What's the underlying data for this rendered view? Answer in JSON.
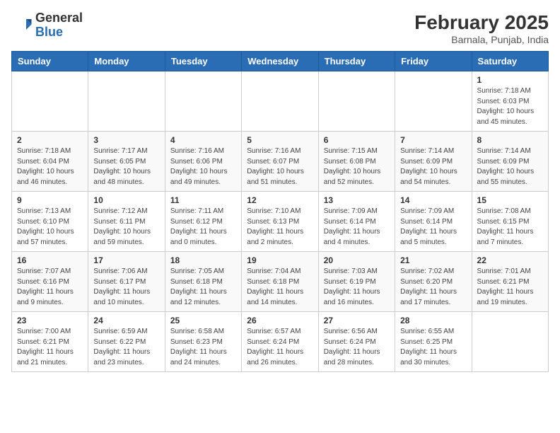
{
  "header": {
    "logo_general": "General",
    "logo_blue": "Blue",
    "month_title": "February 2025",
    "location": "Barnala, Punjab, India"
  },
  "days_of_week": [
    "Sunday",
    "Monday",
    "Tuesday",
    "Wednesday",
    "Thursday",
    "Friday",
    "Saturday"
  ],
  "weeks": [
    [
      {
        "day": "",
        "info": ""
      },
      {
        "day": "",
        "info": ""
      },
      {
        "day": "",
        "info": ""
      },
      {
        "day": "",
        "info": ""
      },
      {
        "day": "",
        "info": ""
      },
      {
        "day": "",
        "info": ""
      },
      {
        "day": "1",
        "info": "Sunrise: 7:18 AM\nSunset: 6:03 PM\nDaylight: 10 hours\nand 45 minutes."
      }
    ],
    [
      {
        "day": "2",
        "info": "Sunrise: 7:18 AM\nSunset: 6:04 PM\nDaylight: 10 hours\nand 46 minutes."
      },
      {
        "day": "3",
        "info": "Sunrise: 7:17 AM\nSunset: 6:05 PM\nDaylight: 10 hours\nand 48 minutes."
      },
      {
        "day": "4",
        "info": "Sunrise: 7:16 AM\nSunset: 6:06 PM\nDaylight: 10 hours\nand 49 minutes."
      },
      {
        "day": "5",
        "info": "Sunrise: 7:16 AM\nSunset: 6:07 PM\nDaylight: 10 hours\nand 51 minutes."
      },
      {
        "day": "6",
        "info": "Sunrise: 7:15 AM\nSunset: 6:08 PM\nDaylight: 10 hours\nand 52 minutes."
      },
      {
        "day": "7",
        "info": "Sunrise: 7:14 AM\nSunset: 6:09 PM\nDaylight: 10 hours\nand 54 minutes."
      },
      {
        "day": "8",
        "info": "Sunrise: 7:14 AM\nSunset: 6:09 PM\nDaylight: 10 hours\nand 55 minutes."
      }
    ],
    [
      {
        "day": "9",
        "info": "Sunrise: 7:13 AM\nSunset: 6:10 PM\nDaylight: 10 hours\nand 57 minutes."
      },
      {
        "day": "10",
        "info": "Sunrise: 7:12 AM\nSunset: 6:11 PM\nDaylight: 10 hours\nand 59 minutes."
      },
      {
        "day": "11",
        "info": "Sunrise: 7:11 AM\nSunset: 6:12 PM\nDaylight: 11 hours\nand 0 minutes."
      },
      {
        "day": "12",
        "info": "Sunrise: 7:10 AM\nSunset: 6:13 PM\nDaylight: 11 hours\nand 2 minutes."
      },
      {
        "day": "13",
        "info": "Sunrise: 7:09 AM\nSunset: 6:14 PM\nDaylight: 11 hours\nand 4 minutes."
      },
      {
        "day": "14",
        "info": "Sunrise: 7:09 AM\nSunset: 6:14 PM\nDaylight: 11 hours\nand 5 minutes."
      },
      {
        "day": "15",
        "info": "Sunrise: 7:08 AM\nSunset: 6:15 PM\nDaylight: 11 hours\nand 7 minutes."
      }
    ],
    [
      {
        "day": "16",
        "info": "Sunrise: 7:07 AM\nSunset: 6:16 PM\nDaylight: 11 hours\nand 9 minutes."
      },
      {
        "day": "17",
        "info": "Sunrise: 7:06 AM\nSunset: 6:17 PM\nDaylight: 11 hours\nand 10 minutes."
      },
      {
        "day": "18",
        "info": "Sunrise: 7:05 AM\nSunset: 6:18 PM\nDaylight: 11 hours\nand 12 minutes."
      },
      {
        "day": "19",
        "info": "Sunrise: 7:04 AM\nSunset: 6:18 PM\nDaylight: 11 hours\nand 14 minutes."
      },
      {
        "day": "20",
        "info": "Sunrise: 7:03 AM\nSunset: 6:19 PM\nDaylight: 11 hours\nand 16 minutes."
      },
      {
        "day": "21",
        "info": "Sunrise: 7:02 AM\nSunset: 6:20 PM\nDaylight: 11 hours\nand 17 minutes."
      },
      {
        "day": "22",
        "info": "Sunrise: 7:01 AM\nSunset: 6:21 PM\nDaylight: 11 hours\nand 19 minutes."
      }
    ],
    [
      {
        "day": "23",
        "info": "Sunrise: 7:00 AM\nSunset: 6:21 PM\nDaylight: 11 hours\nand 21 minutes."
      },
      {
        "day": "24",
        "info": "Sunrise: 6:59 AM\nSunset: 6:22 PM\nDaylight: 11 hours\nand 23 minutes."
      },
      {
        "day": "25",
        "info": "Sunrise: 6:58 AM\nSunset: 6:23 PM\nDaylight: 11 hours\nand 24 minutes."
      },
      {
        "day": "26",
        "info": "Sunrise: 6:57 AM\nSunset: 6:24 PM\nDaylight: 11 hours\nand 26 minutes."
      },
      {
        "day": "27",
        "info": "Sunrise: 6:56 AM\nSunset: 6:24 PM\nDaylight: 11 hours\nand 28 minutes."
      },
      {
        "day": "28",
        "info": "Sunrise: 6:55 AM\nSunset: 6:25 PM\nDaylight: 11 hours\nand 30 minutes."
      },
      {
        "day": "",
        "info": ""
      }
    ]
  ]
}
